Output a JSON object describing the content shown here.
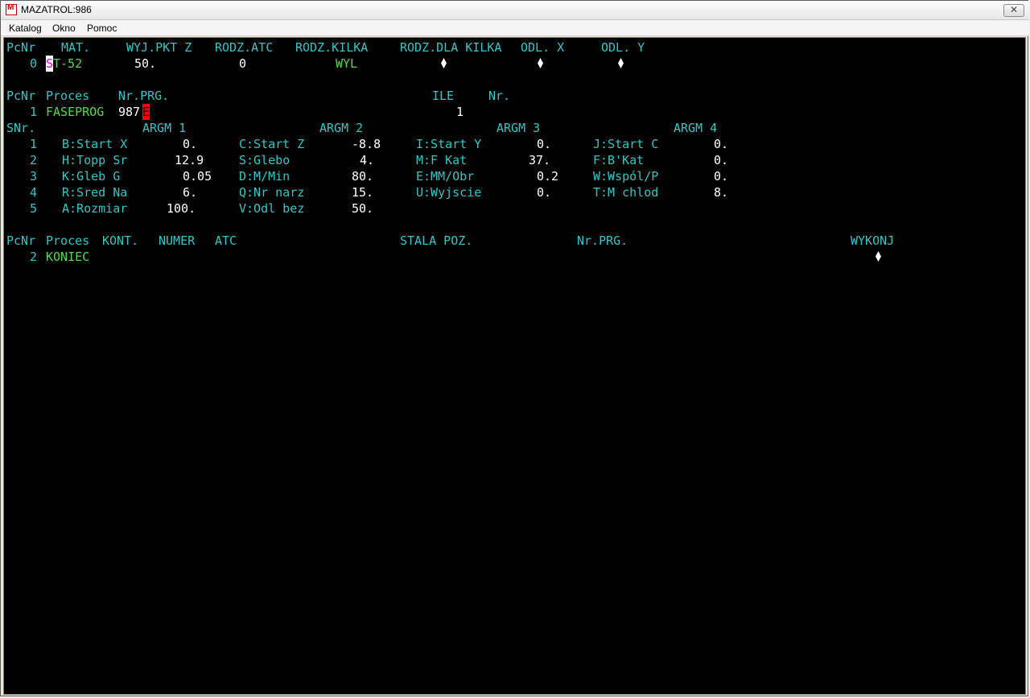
{
  "window": {
    "title": "MAZATROL:986",
    "close_glyph": "✕"
  },
  "menu": [
    "Katalog",
    "Okno",
    "Pomoc"
  ],
  "section1": {
    "header": [
      "PcNr",
      "MAT.",
      "WYJ.PKT Z",
      "RODZ.ATC",
      "RODZ.KILKA",
      "RODZ.DLA KILKA",
      "ODL. X",
      "ODL. Y"
    ],
    "row": {
      "pcnr": "0",
      "mat_cursor": "S",
      "mat_rest": "T-52",
      "wyj_pkt_z": "50.",
      "rodz_atc": "0",
      "rodz_kilka": "WYL"
    }
  },
  "section2": {
    "header": [
      "PcNr",
      "Proces",
      "Nr.PRG.",
      "ILE",
      "Nr."
    ],
    "row": {
      "pcnr": "1",
      "proces": "FASEPROG",
      "nr_prg": "987",
      "nr_prg_cursor": "E",
      "ile": "1"
    },
    "args_header": [
      "SNr.",
      "ARGM 1",
      "ARGM 2",
      "ARGM 3",
      "ARGM 4"
    ],
    "args": [
      {
        "snr": "1",
        "a1": "B:Start X",
        "v1": "0.",
        "a2": "C:Start Z",
        "v2": "-8.8",
        "a3": "I:Start Y",
        "v3": "0.",
        "a4": "J:Start C",
        "v4": "0."
      },
      {
        "snr": "2",
        "a1": "H:Topp Sr",
        "v1": "12.9",
        "a2": "S:Glebo",
        "v2": "4.",
        "a3": "M:F Kat",
        "v3": "37.",
        "a4": "F:B'Kat",
        "v4": "0."
      },
      {
        "snr": "3",
        "a1": "K:Gleb G",
        "v1": "0.05",
        "a2": "D:M/Min",
        "v2": "80.",
        "a3": "E:MM/Obr",
        "v3": "0.2",
        "a4": "W:Wspól/P",
        "v4": "0."
      },
      {
        "snr": "4",
        "a1": "R:Sred Na",
        "v1": "6.",
        "a2": "Q:Nr narz",
        "v2": "15.",
        "a3": "U:Wyjscie",
        "v3": "0.",
        "a4": "T:M chlod",
        "v4": "8."
      },
      {
        "snr": "5",
        "a1": "A:Rozmiar",
        "v1": "100.",
        "a2": "V:Odl bez",
        "v2": "50."
      }
    ]
  },
  "section3": {
    "header": [
      "PcNr",
      "Proces",
      "KONT.",
      "NUMER",
      "ATC",
      "STALA POZ.",
      "Nr.PRG.",
      "WYKONJ"
    ],
    "row": {
      "pcnr": "2",
      "proces": "KONIEC"
    }
  }
}
